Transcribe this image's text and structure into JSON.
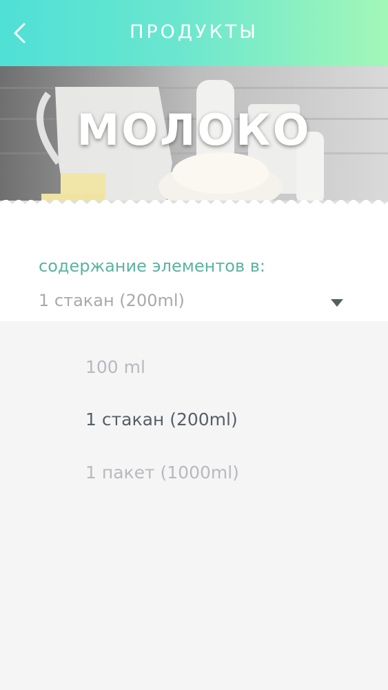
{
  "header": {
    "title": "ПРОДУКТЫ",
    "back_icon": "chevron-left-icon"
  },
  "hero": {
    "title": "МОЛОКО"
  },
  "selector": {
    "label": "содержание элементов в:",
    "value": "1 стакан (200ml)",
    "caret_icon": "caret-down-icon"
  },
  "options": [
    {
      "label": "100 ml",
      "selected": false
    },
    {
      "label": "1 стакан (200ml)",
      "selected": true
    },
    {
      "label": "1 пакет (1000ml)",
      "selected": false
    }
  ],
  "colors": {
    "header_gradient_start": "#4fe0d6",
    "header_gradient_end": "#a2f7b8",
    "label_accent": "#5bb3a0",
    "option_active": "#565f66",
    "option_muted": "#b8b8bf",
    "list_background": "#f5f5f5"
  }
}
